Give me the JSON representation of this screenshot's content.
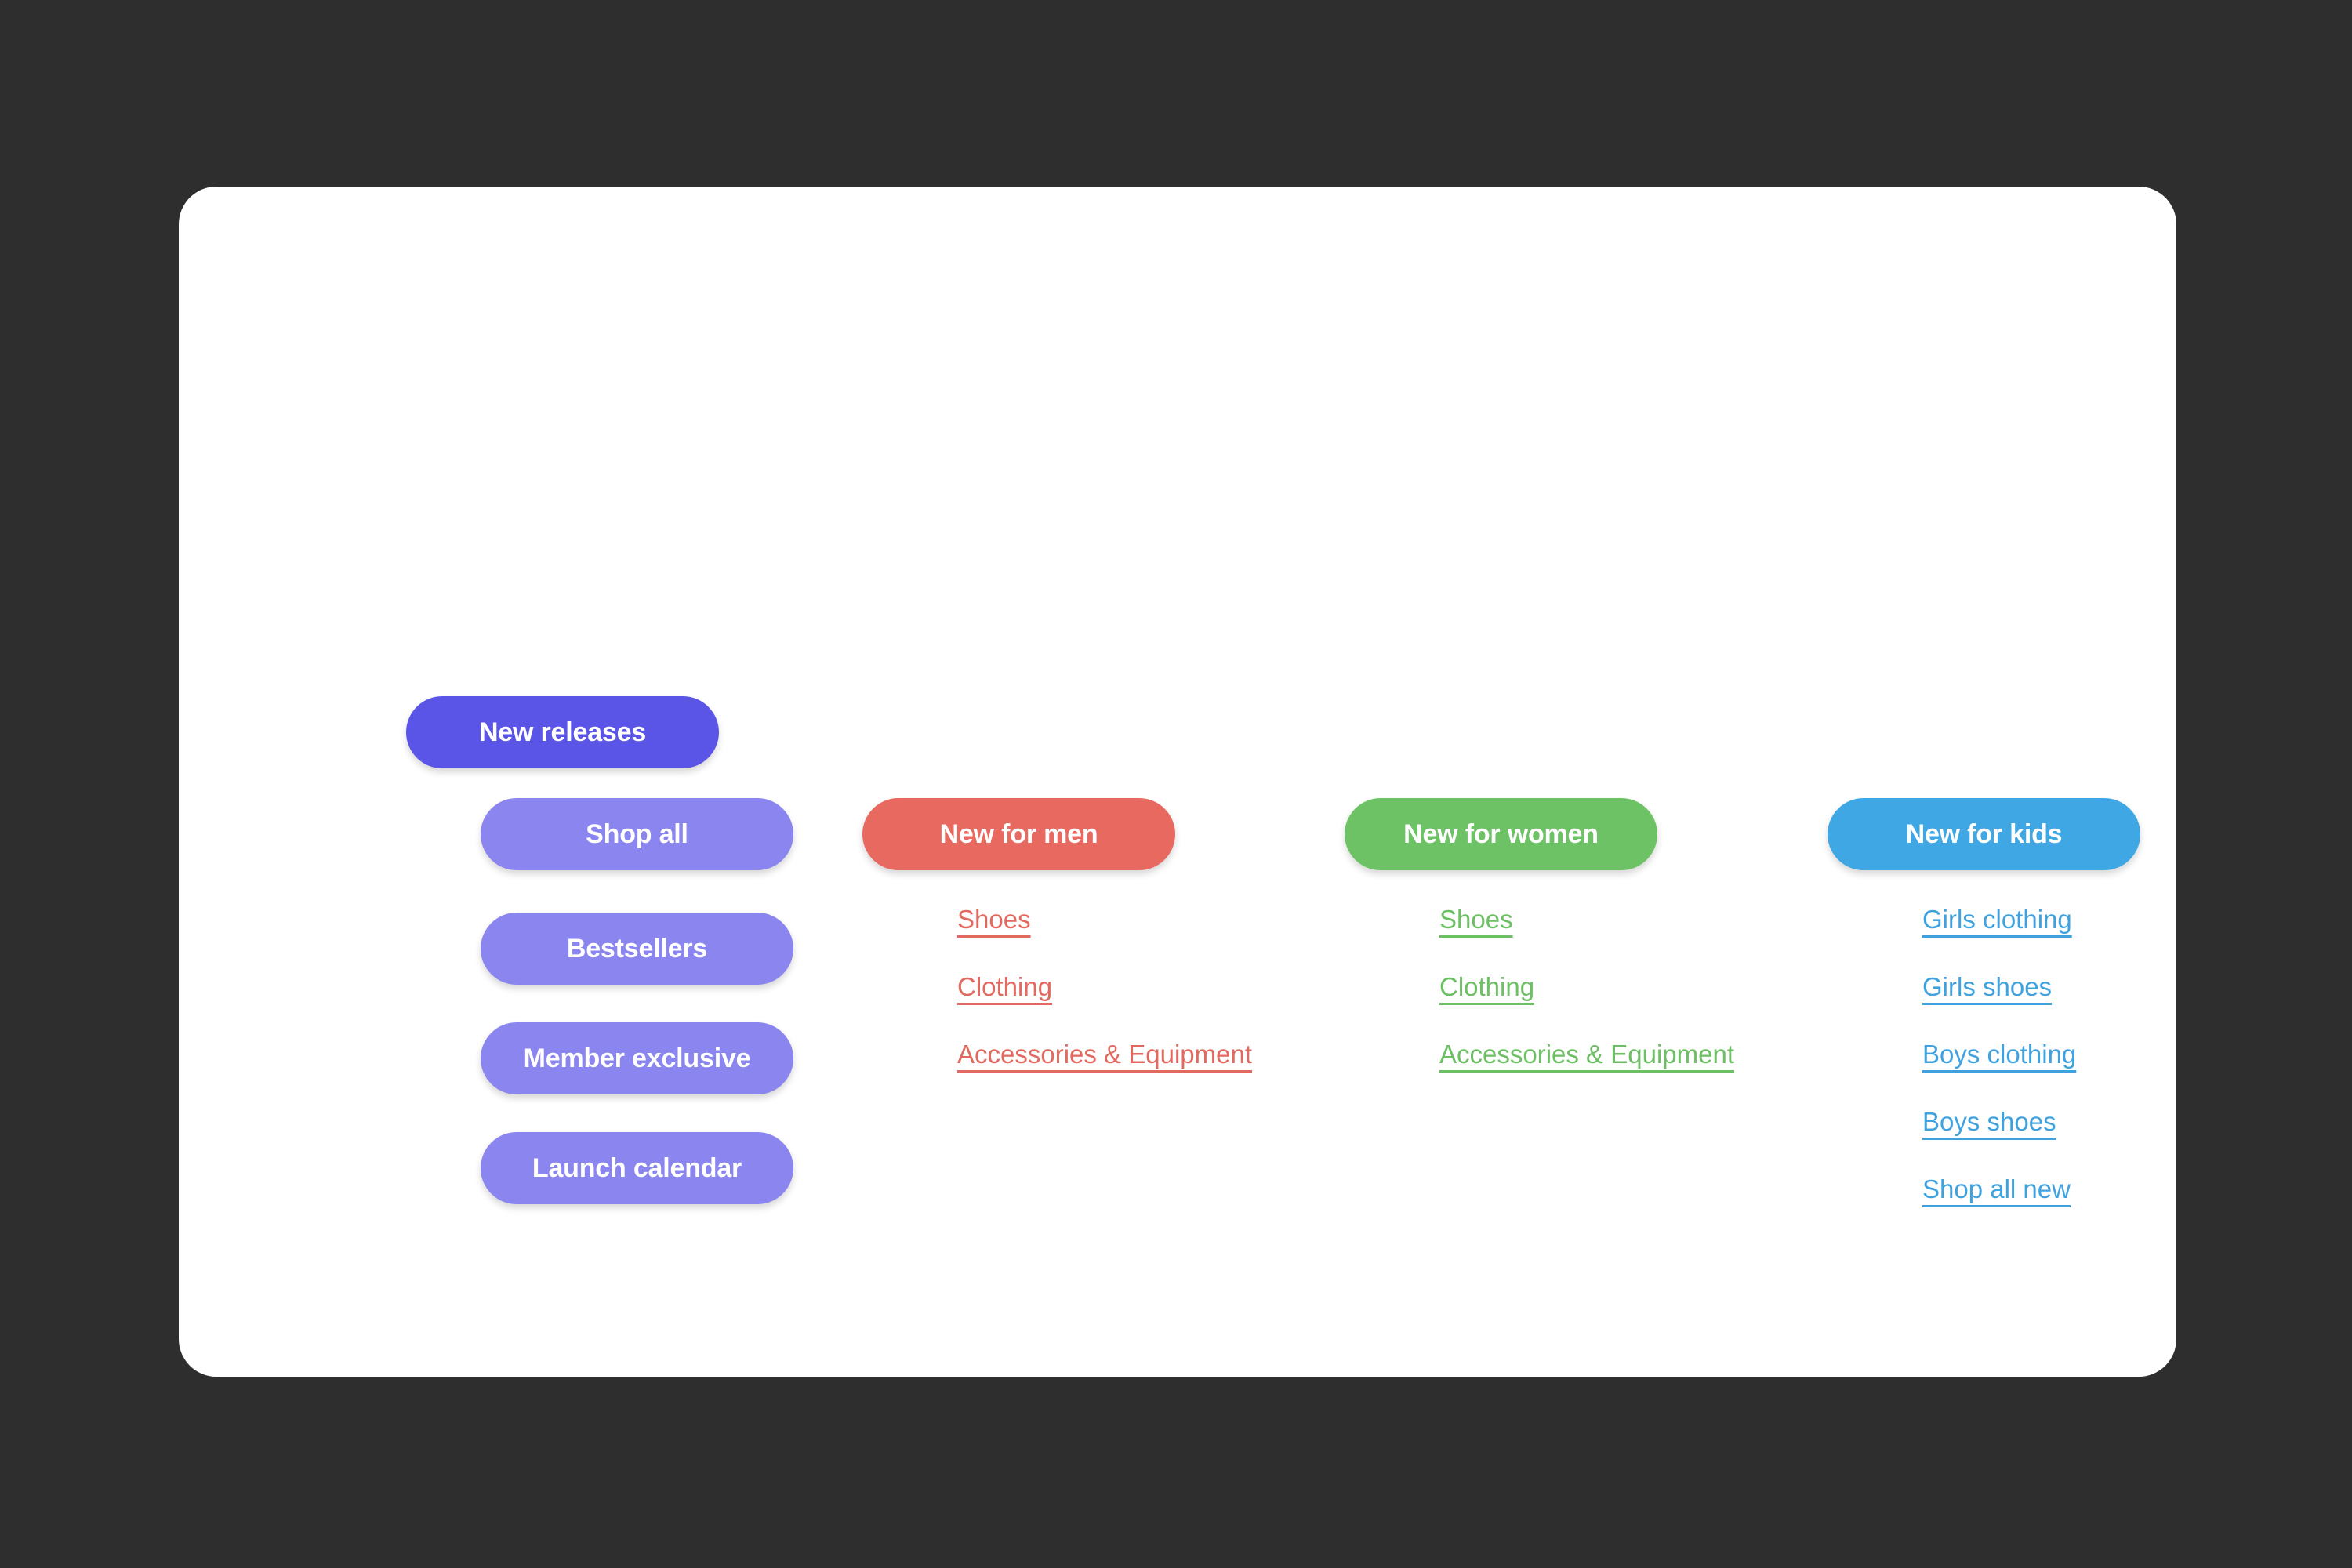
{
  "page": {
    "background_color": "#2e2e2e",
    "card_background": "#ffffff"
  },
  "menu": {
    "root": {
      "label": "New releases",
      "color": "#5a55e6"
    },
    "sidebar": {
      "color": "#8b85f0",
      "items": [
        {
          "label": "Shop all"
        },
        {
          "label": "Bestsellers"
        },
        {
          "label": "Member exclusive"
        },
        {
          "label": "Launch calendar"
        }
      ]
    },
    "columns": [
      {
        "heading": "New for men",
        "color": "#e8695f",
        "link_color": "#e2695f",
        "links": [
          {
            "label": "Shoes"
          },
          {
            "label": "Clothing"
          },
          {
            "label": "Accessories & Equipment"
          }
        ]
      },
      {
        "heading": "New for women",
        "color": "#6cc264",
        "link_color": "#6cbf63",
        "links": [
          {
            "label": "Shoes"
          },
          {
            "label": "Clothing"
          },
          {
            "label": "Accessories & Equipment"
          }
        ]
      },
      {
        "heading": "New for kids",
        "color": "#3fa7e3",
        "link_color": "#3fa2de",
        "links": [
          {
            "label": "Girls clothing"
          },
          {
            "label": "Girls shoes"
          },
          {
            "label": "Boys clothing"
          },
          {
            "label": "Boys shoes"
          },
          {
            "label": "Shop all new"
          }
        ]
      }
    ]
  }
}
